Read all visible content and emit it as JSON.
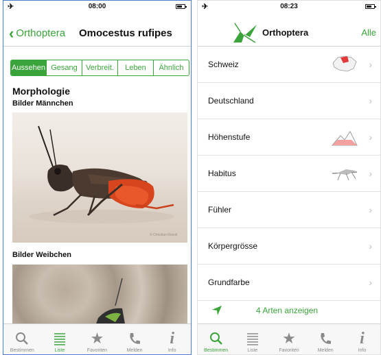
{
  "left": {
    "status": {
      "time": "08:00"
    },
    "nav": {
      "back_label": "Orthoptera",
      "title": "Omocestus rufipes"
    },
    "segments": [
      "Aussehen",
      "Gesang",
      "Verbreit.",
      "Leben",
      "Ähnlich"
    ],
    "section_title": "Morphologie",
    "images": [
      {
        "label": "Bilder Männchen",
        "caption": "© Christian Roesti"
      },
      {
        "label": "Bilder Weibchen"
      }
    ],
    "tabs": [
      {
        "label": "Bestimmen",
        "icon": "search-icon"
      },
      {
        "label": "Liste",
        "icon": "list-icon"
      },
      {
        "label": "Favoriten",
        "icon": "star-icon"
      },
      {
        "label": "Melden",
        "icon": "phone-icon"
      },
      {
        "label": "Info",
        "icon": "info-icon"
      }
    ]
  },
  "right": {
    "status": {
      "time": "08:23"
    },
    "nav": {
      "title": "Orthoptera",
      "right_button": "Alle"
    },
    "rows": [
      {
        "label": "Schweiz",
        "thumb": "map"
      },
      {
        "label": "Deutschland"
      },
      {
        "label": "Höhenstufe",
        "thumb": "altitude"
      },
      {
        "label": "Habitus",
        "thumb": "habitus"
      },
      {
        "label": "Fühler"
      },
      {
        "label": "Körpergrösse"
      },
      {
        "label": "Grundfarbe"
      }
    ],
    "footer": {
      "label": "4 Arten anzeigen"
    },
    "tabs": [
      {
        "label": "Bestimmen",
        "icon": "search-icon"
      },
      {
        "label": "Liste",
        "icon": "list-icon"
      },
      {
        "label": "Favoriten",
        "icon": "star-icon"
      },
      {
        "label": "Melden",
        "icon": "phone-icon"
      },
      {
        "label": "Info",
        "icon": "info-icon"
      }
    ]
  },
  "colors": {
    "accent": "#3aa43a",
    "frame": "#4a7bd0",
    "map_highlight": "#e23a3a"
  }
}
